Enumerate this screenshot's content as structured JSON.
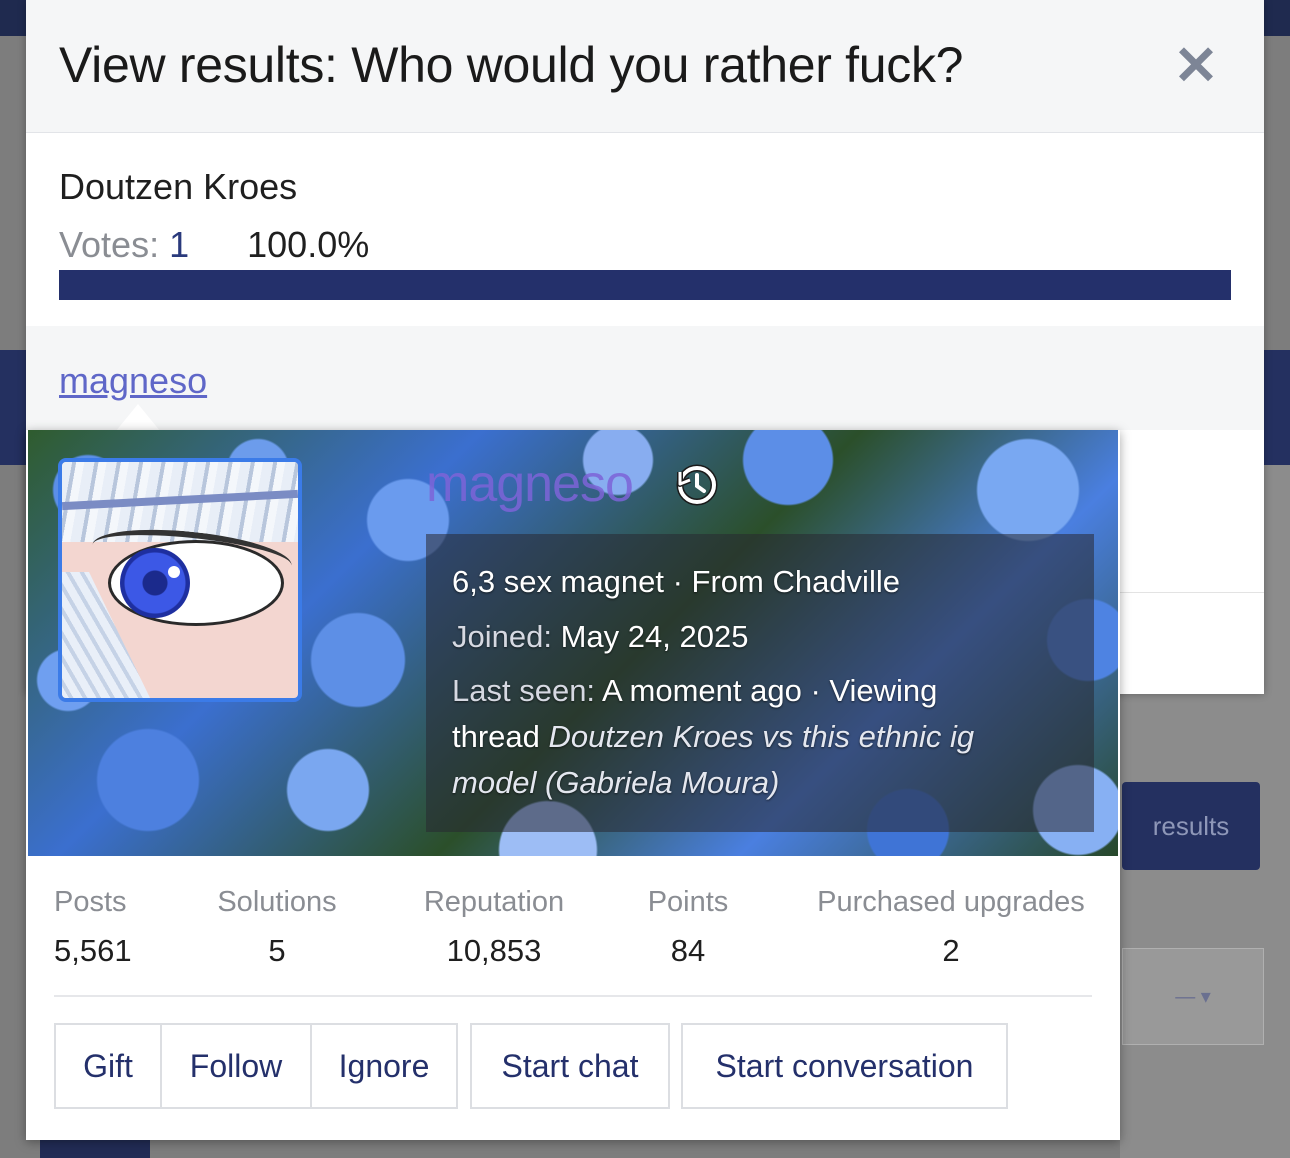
{
  "modal": {
    "title": "View results: Who would you rather fuck?",
    "close_icon": "close-icon"
  },
  "poll": {
    "option_name": "Doutzen Kroes",
    "votes_label": "Votes:",
    "votes_count": "1",
    "percent_text": "100.0%",
    "percent_value": 100.0,
    "bar_color": "#24306b"
  },
  "voter": {
    "username": "magneso"
  },
  "member_card": {
    "username": "magneso",
    "history_icon": "history-icon",
    "title_line": "6,3 sex magnet · From Chadville",
    "joined_label": "Joined:",
    "joined_value": "May 24, 2025",
    "last_seen_label": "Last seen:",
    "last_seen_value": "A moment ago · Viewing",
    "activity_prefix": "thread",
    "activity_thread_line1": "Doutzen Kroes vs this ethnic ig",
    "activity_thread_line2": "model (Gabriela Moura)",
    "username_color": "#7d64d8",
    "stats": [
      {
        "label": "Posts",
        "value": "5,561"
      },
      {
        "label": "Solutions",
        "value": "5"
      },
      {
        "label": "Reputation",
        "value": "10,853"
      },
      {
        "label": "Points",
        "value": "84"
      },
      {
        "label": "Purchased upgrades",
        "value": "2"
      }
    ],
    "actions": {
      "gift": "Gift",
      "follow": "Follow",
      "ignore": "Ignore",
      "start_chat": "Start chat",
      "start_conversation": "Start conversation"
    }
  },
  "background": {
    "partial_button_text": "results",
    "partial_select_text": "— ▾"
  }
}
